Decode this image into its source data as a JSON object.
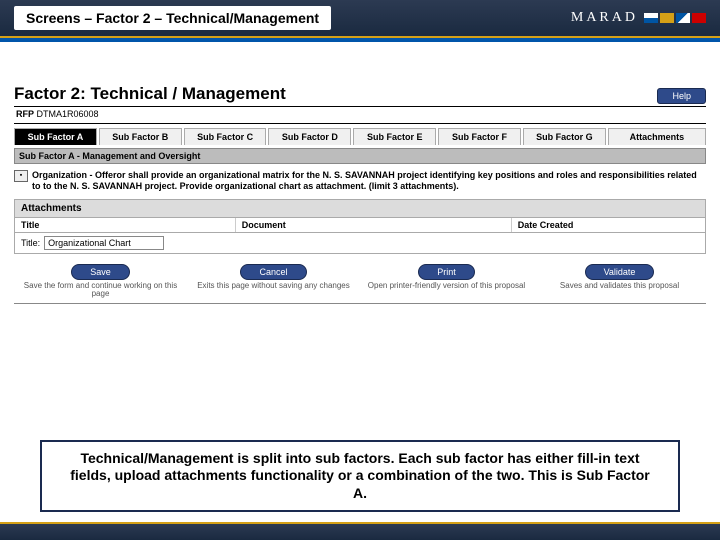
{
  "topbar": {
    "title": "Screens – Factor 2 – Technical/Management",
    "brand": "MARAD"
  },
  "factor": {
    "heading": "Factor 2: Technical / Management",
    "help_label": "Help"
  },
  "rfp": {
    "label": "RFP",
    "value": "DTMA1R06008"
  },
  "tabs": [
    {
      "label": "Sub Factor A",
      "active": true
    },
    {
      "label": "Sub Factor B"
    },
    {
      "label": "Sub Factor C"
    },
    {
      "label": "Sub Factor D"
    },
    {
      "label": "Sub Factor E"
    },
    {
      "label": "Sub Factor F"
    },
    {
      "label": "Sub Factor G"
    },
    {
      "label": "Attachments"
    }
  ],
  "subfactor_bar": "Sub Factor A - Management and Oversight",
  "org_text": "Organization - Offeror shall provide an organizational matrix for the N. S. SAVANNAH project identifying key positions and roles and responsibilities related to to the N. S. SAVANNAH project.  Provide organizational chart as attachment. (limit 3 attachments).",
  "attachments": {
    "header": "Attachments",
    "cols": {
      "title": "Title",
      "document": "Document",
      "date": "Date Created"
    },
    "input": {
      "label": "Title:",
      "value": "Organizational Chart"
    }
  },
  "actions": [
    {
      "label": "Save",
      "desc": "Save the form and continue working on this page"
    },
    {
      "label": "Cancel",
      "desc": "Exits this page without saving any changes"
    },
    {
      "label": "Print",
      "desc": "Open printer-friendly version of this proposal"
    },
    {
      "label": "Validate",
      "desc": "Saves and validates this proposal"
    }
  ],
  "caption": "Technical/Management is split into sub factors.  Each sub factor has either fill-in text fields, upload attachments functionality or a combination of the two.  This is Sub Factor A."
}
